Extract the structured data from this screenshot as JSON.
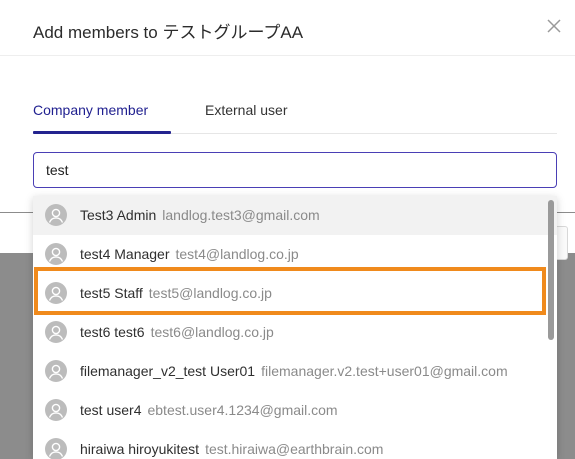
{
  "dialog": {
    "title": "Add members to テストグループAA",
    "close_icon": "close-icon"
  },
  "tabs": [
    {
      "label": "Company member",
      "active": true
    },
    {
      "label": "External user",
      "active": false
    }
  ],
  "search": {
    "value": "test"
  },
  "dropdown": {
    "items": [
      {
        "name": "Test3 Admin",
        "email": "landlog.test3@gmail.com"
      },
      {
        "name": "test4 Manager",
        "email": "test4@landlog.co.jp"
      },
      {
        "name": "test5 Staff",
        "email": "test5@landlog.co.jp"
      },
      {
        "name": "test6 test6",
        "email": "test6@landlog.co.jp"
      },
      {
        "name": "filemanager_v2_test User01",
        "email": "filemanager.v2.test+user01@gmail.com"
      },
      {
        "name": "test user4",
        "email": "ebtest.user4.1234@gmail.com"
      },
      {
        "name": "hiraiwa hiroyukitest",
        "email": "test.hiraiwa@earthbrain.com"
      }
    ],
    "hovered_index": 0,
    "highlighted_index": 2
  },
  "colors": {
    "accent": "#23238f",
    "highlight": "#f08a1c",
    "avatar": "#bcbcbc"
  }
}
